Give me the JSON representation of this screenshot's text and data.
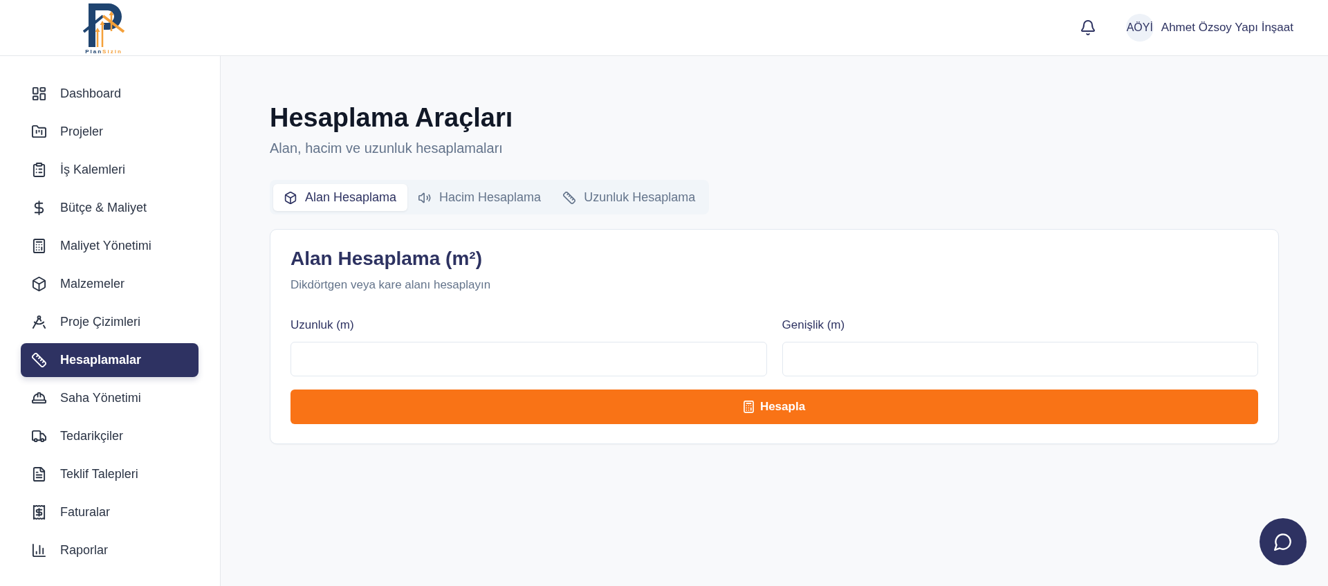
{
  "header": {
    "logo": {
      "primary": "Plan",
      "accent": "Sizin"
    },
    "user": {
      "initials": "AÖYİ",
      "name": "Ahmet Özsoy Yapı İnşaat"
    }
  },
  "sidebar": {
    "items": [
      {
        "label": "Dashboard",
        "selected": false
      },
      {
        "label": "Projeler",
        "selected": false
      },
      {
        "label": "İş Kalemleri",
        "selected": false
      },
      {
        "label": "Bütçe & Maliyet",
        "selected": false
      },
      {
        "label": "Maliyet Yönetimi",
        "selected": false
      },
      {
        "label": "Malzemeler",
        "selected": false
      },
      {
        "label": "Proje Çizimleri",
        "selected": false
      },
      {
        "label": "Hesaplamalar",
        "selected": true
      },
      {
        "label": "Saha Yönetimi",
        "selected": false
      },
      {
        "label": "Tedarikçiler",
        "selected": false
      },
      {
        "label": "Teklif Talepleri",
        "selected": false
      },
      {
        "label": "Faturalar",
        "selected": false
      },
      {
        "label": "Raporlar",
        "selected": false
      }
    ]
  },
  "page": {
    "title": "Hesaplama Araçları",
    "subtitle": "Alan, hacim ve uzunluk hesaplamaları"
  },
  "tabs": [
    {
      "label": "Alan Hesaplama",
      "selected": true
    },
    {
      "label": "Hacim Hesaplama",
      "selected": false
    },
    {
      "label": "Uzunluk Hesaplama",
      "selected": false
    }
  ],
  "card": {
    "title": "Alan Hesaplama (m²)",
    "subtitle": "Dikdörtgen veya kare alanı hesaplayın",
    "fields": [
      {
        "label": "Uzunluk (m)"
      },
      {
        "label": "Genişlik (m)"
      }
    ],
    "button": "Hesapla"
  }
}
